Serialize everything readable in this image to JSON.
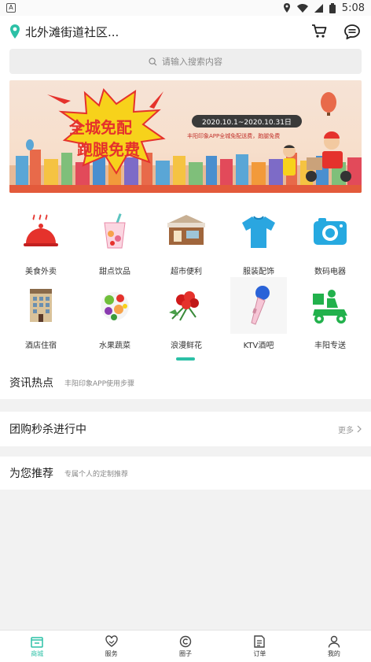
{
  "status_bar": {
    "time": "5:08",
    "app_badge": "A"
  },
  "header": {
    "location": "北外滩街道社区...",
    "cart_icon": "cart-icon",
    "message_icon": "chat-icon"
  },
  "search": {
    "placeholder": "请输入搜索内容"
  },
  "banner": {
    "headline1": "全城免配",
    "headline2": "跑腿免费",
    "date_range": "2020.10.1~2020.10.31日",
    "subtext": "丰阳印象APP全城免配送费，跑腿免费"
  },
  "categories": [
    {
      "label": "美食外卖",
      "icon": "cloche-icon"
    },
    {
      "label": "甜点饮品",
      "icon": "drink-icon"
    },
    {
      "label": "超市便利",
      "icon": "store-icon"
    },
    {
      "label": "服装配饰",
      "icon": "tshirt-icon"
    },
    {
      "label": "数码电器",
      "icon": "camera-icon"
    },
    {
      "label": "酒店住宿",
      "icon": "hotel-icon"
    },
    {
      "label": "水果蔬菜",
      "icon": "fruit-icon"
    },
    {
      "label": "浪漫鲜花",
      "icon": "flower-icon"
    },
    {
      "label": "KTV酒吧",
      "icon": "microphone-icon"
    },
    {
      "label": "丰阳专送",
      "icon": "delivery-icon"
    }
  ],
  "news": {
    "title": "资讯热点",
    "subtitle": "丰阳印象APP使用步骤"
  },
  "groupbuy": {
    "title": "团购秒杀进行中",
    "more": "更多"
  },
  "recommend": {
    "title": "为您推荐",
    "subtitle": "专属个人的定制推荐"
  },
  "tabs": [
    {
      "label": "商城",
      "icon": "store-tab-icon",
      "active": true
    },
    {
      "label": "服务",
      "icon": "heart-hand-icon",
      "active": false
    },
    {
      "label": "圈子",
      "icon": "circle-icon",
      "active": false
    },
    {
      "label": "订单",
      "icon": "order-icon",
      "active": false
    },
    {
      "label": "我的",
      "icon": "user-icon",
      "active": false
    }
  ],
  "colors": {
    "accent": "#2cc0a6",
    "banner_red": "#e5322c",
    "banner_yellow": "#f7d21b"
  }
}
